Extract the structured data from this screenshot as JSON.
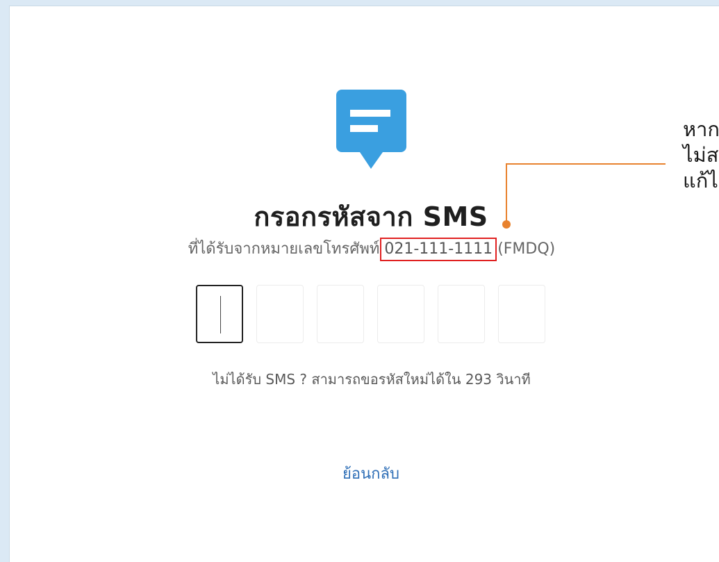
{
  "header": {
    "title": "กรอกรหัสจาก SMS",
    "subtitle_prefix": "ที่ได้รับจากหมายเลขโทรศัพท์",
    "phone_number": "021-111-1111",
    "reference_code": "(FMDQ)"
  },
  "otp": {
    "digits": [
      "",
      "",
      "",
      "",
      "",
      ""
    ]
  },
  "resend": {
    "text": "ไม่ได้รับ SMS ? สามารถขอรหัสใหม่ได้ใน 293 วินาที"
  },
  "actions": {
    "back_label": "ย้อนกลับ"
  },
  "annotation": {
    "lines": [
      "หาก",
      "ไม่ส",
      "แก้ไ"
    ]
  },
  "colors": {
    "accent": "#2f6fb7",
    "icon_blue": "#3a9fe0",
    "highlight_box": "#e02020",
    "callout_orange": "#e8822e"
  },
  "icons": {
    "sms": "message-bubble-icon"
  }
}
